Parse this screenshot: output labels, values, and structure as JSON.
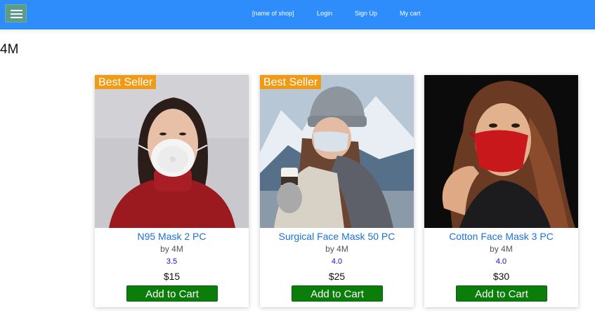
{
  "nav": {
    "shop_name": "[name of shop]",
    "login": "Login",
    "signup": "Sign Up",
    "cart": "My cart",
    "menu_icon": "hamburger-menu-icon",
    "bar_color": "#2e8dfb"
  },
  "store": {
    "title": "4M"
  },
  "products": [
    {
      "badge": "Best Seller",
      "name": "N95 Mask 2 PC",
      "brand": "by 4M",
      "rating": "3.5",
      "price": "$15",
      "button": "Add to Cart",
      "image": "woman-wearing-white-n95-mask-red-turtleneck"
    },
    {
      "badge": "Best Seller",
      "name": "Surgical Face Mask 50 PC",
      "brand": "by 4M",
      "rating": "4.0",
      "price": "$25",
      "button": "Add to Cart",
      "image": "woman-in-beanie-surgical-mask-holding-coffee-snowy-mountains"
    },
    {
      "badge": "",
      "name": "Cotton Face Mask 3 PC",
      "brand": "by 4M",
      "rating": "4.0",
      "price": "$30",
      "button": "Add to Cart",
      "image": "woman-adjusting-red-cloth-mask-dark-background"
    }
  ],
  "colors": {
    "badge": "#f39a14",
    "link": "#1a73d9",
    "rating": "#1010d0",
    "button": "#0b7d0b"
  }
}
